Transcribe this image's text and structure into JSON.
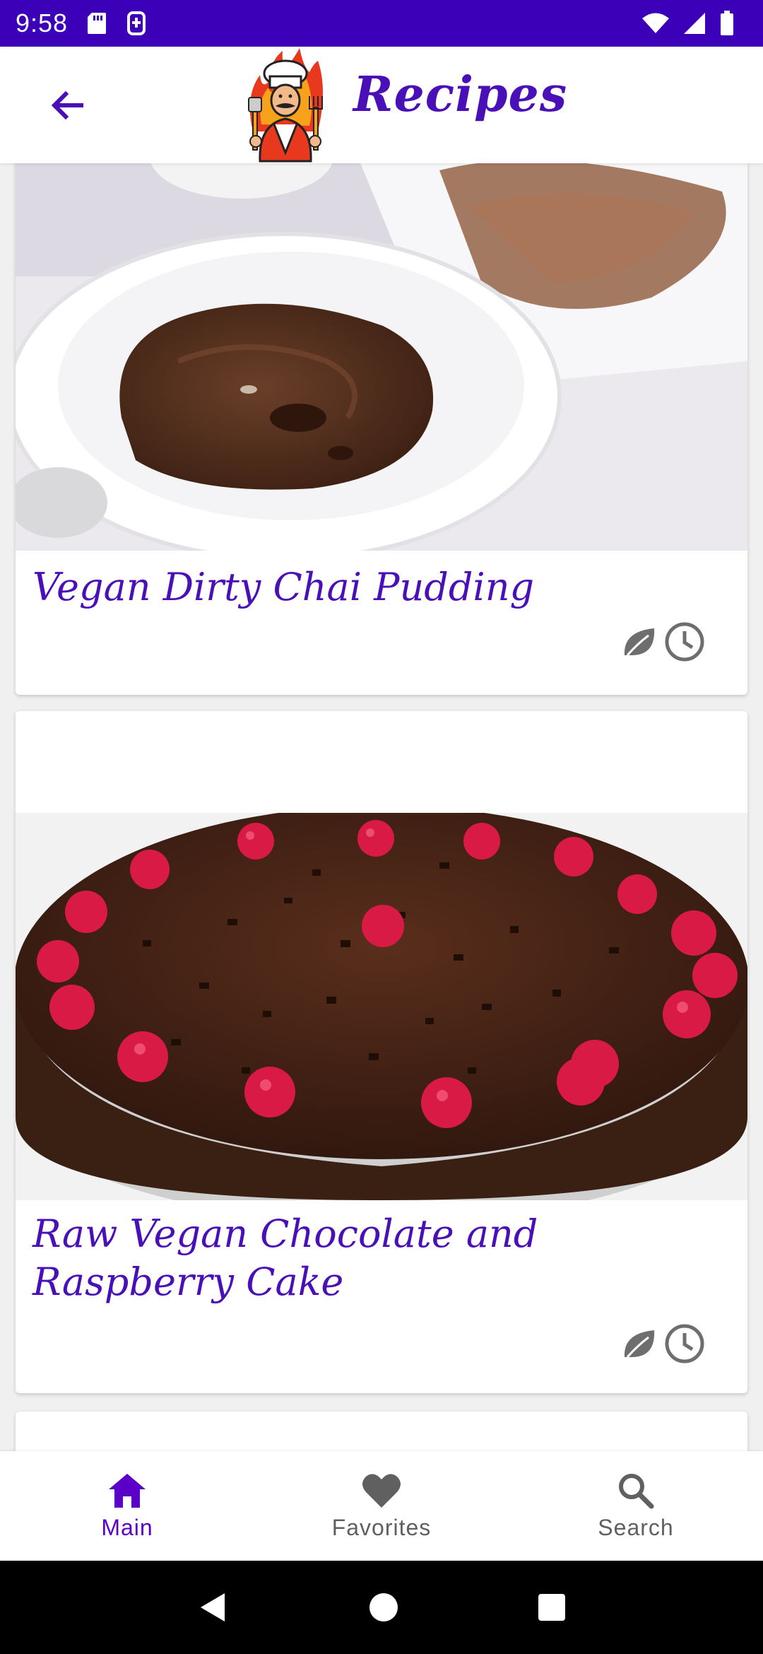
{
  "status_bar": {
    "time": "9:58"
  },
  "app_bar": {
    "title": "Recipes"
  },
  "recipes": [
    {
      "title": "Vegan Dirty Chai Pudding"
    },
    {
      "title": "Raw Vegan Chocolate and Raspberry Cake"
    }
  ],
  "bottom_nav": {
    "items": [
      {
        "label": "Main",
        "icon": "home-icon",
        "active": true
      },
      {
        "label": "Favorites",
        "icon": "heart-icon",
        "active": false
      },
      {
        "label": "Search",
        "icon": "search-icon",
        "active": false
      }
    ]
  },
  "colors": {
    "status_bar": "#3b00b8",
    "accent": "#4a10b8",
    "nav_active": "#5a00c8",
    "nav_inactive": "#606060"
  }
}
